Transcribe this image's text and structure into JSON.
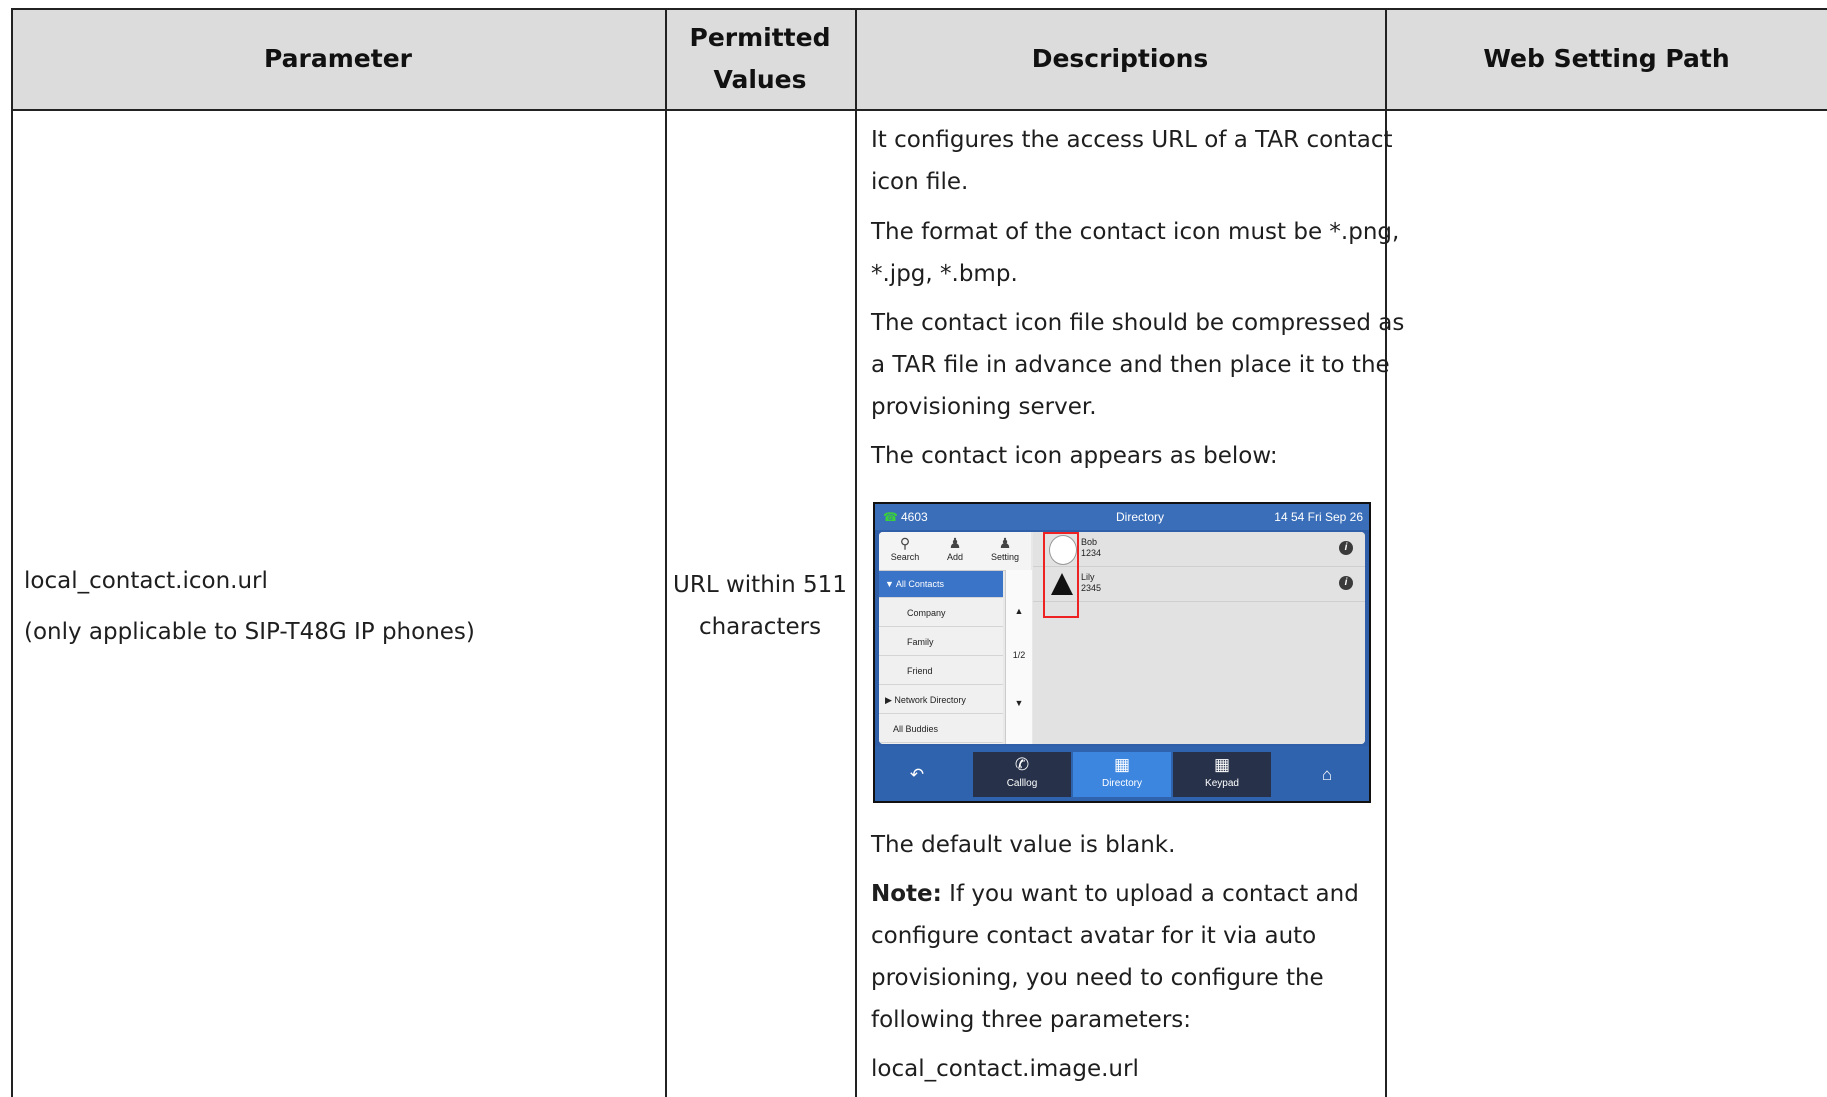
{
  "table": {
    "headers": {
      "parameter": "Parameter",
      "permitted_line1": "Permitted",
      "permitted_line2": "Values",
      "descriptions": "Descriptions",
      "web_path": "Web Setting Path"
    },
    "row": {
      "parameter_name": "local_contact.icon.url",
      "parameter_note": "(only applicable to SIP-T48G IP phones)",
      "permitted_line1": "URL within 511",
      "permitted_line2": "characters",
      "desc_lines": [
        "It configures the access URL of a TAR contact",
        "icon file.",
        "The format of the contact icon must be *.png,",
        "*.jpg, *.bmp.",
        "The contact icon file should be compressed as",
        "a TAR file in advance and then place it to the",
        "provisioning server.",
        "The contact icon appears as below:",
        "The default value is blank.",
        "Note:",
        " If you want to upload a contact and",
        "configure contact avatar for it via auto",
        "provisioning, you need to configure the",
        "following three parameters:",
        "local_contact.image.url"
      ],
      "web_path": ""
    }
  },
  "phone_screen": {
    "status_number": "4603",
    "title": "Directory",
    "datetime": "14 54 Fri Sep 26",
    "tools": [
      "Search",
      "Add",
      "Setting"
    ],
    "groups": [
      "All Contacts",
      "Company",
      "Family",
      "Friend",
      "Network Directory",
      "All Buddies"
    ],
    "page_indicator": "1/2",
    "contacts": [
      {
        "name": "Bob",
        "number": "1234"
      },
      {
        "name": "Lily",
        "number": "2345"
      }
    ],
    "softkeys": [
      "Calllog",
      "Directory",
      "Keypad"
    ],
    "icons": [
      "phone-icon",
      "search-icon",
      "add-contact-icon",
      "setting-icon",
      "back-icon",
      "calllog-icon",
      "directory-icon",
      "keypad-icon",
      "home-icon",
      "info-icon"
    ]
  }
}
